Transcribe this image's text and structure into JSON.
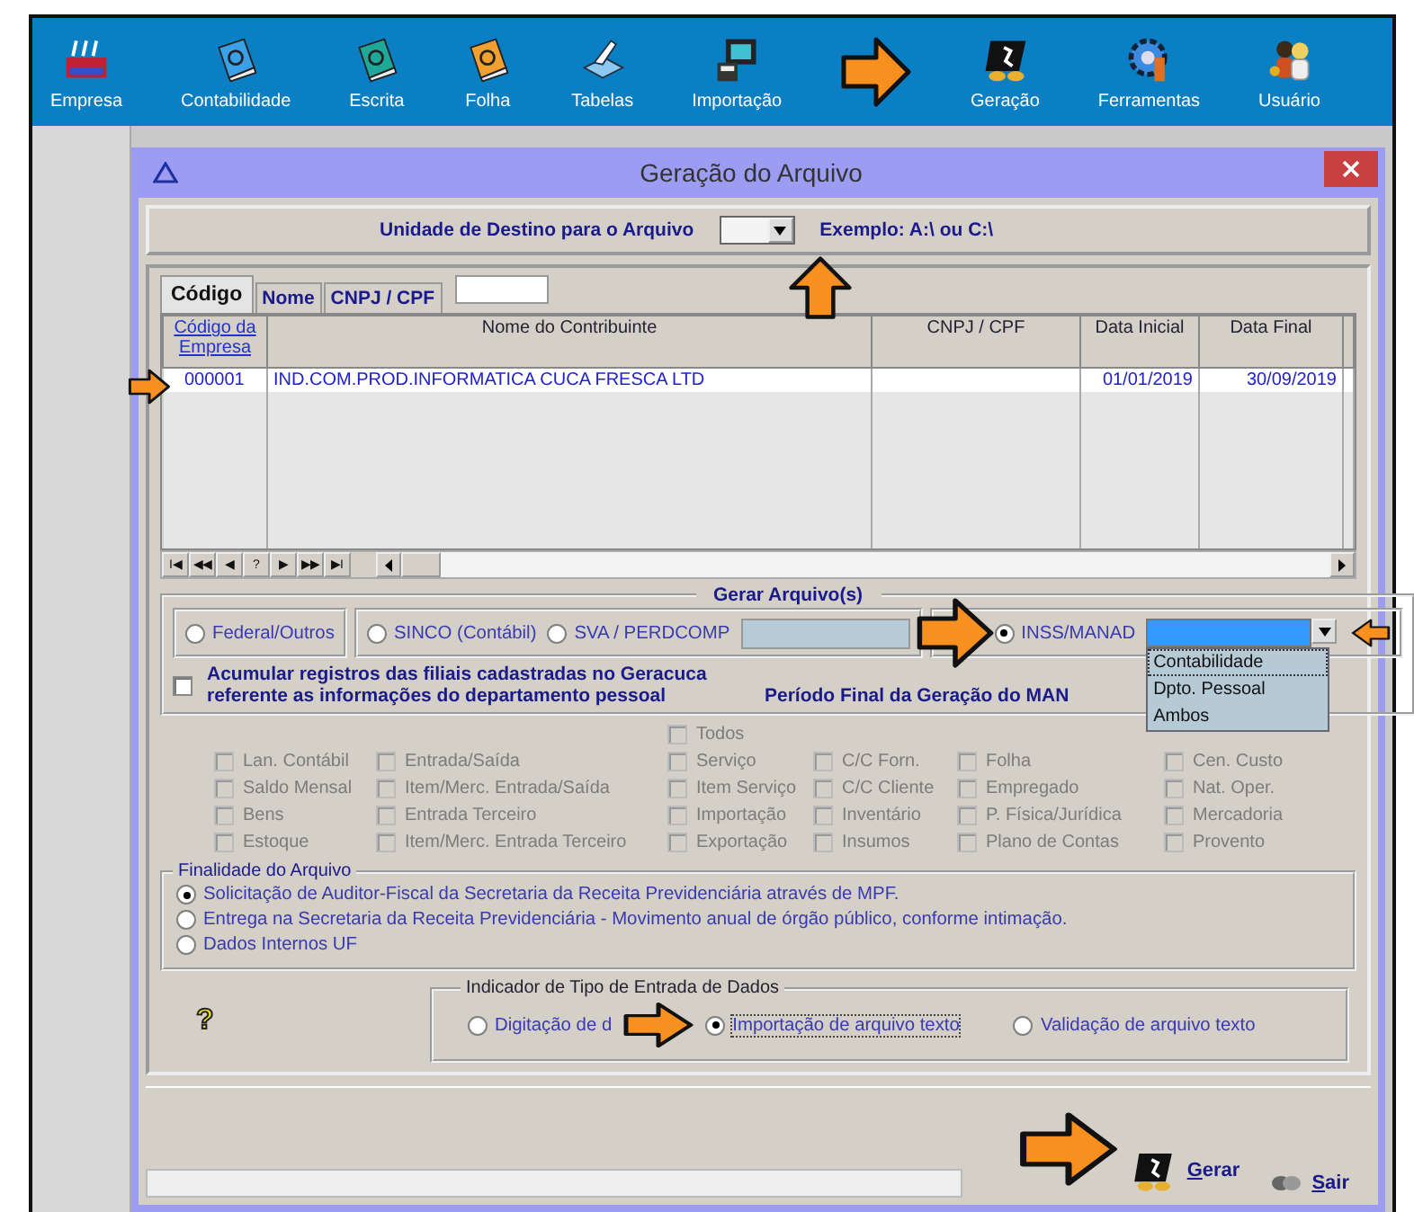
{
  "toolbar": {
    "items": [
      {
        "label": "Empresa"
      },
      {
        "label": "Contabilidade"
      },
      {
        "label": "Escrita"
      },
      {
        "label": "Folha"
      },
      {
        "label": "Tabelas"
      },
      {
        "label": "Importação"
      },
      {
        "label": "Geração"
      },
      {
        "label": "Ferramentas"
      },
      {
        "label": "Usuário"
      }
    ]
  },
  "dialog": {
    "title": "Geração do Arquivo",
    "destination": {
      "label": "Unidade de Destino para o Arquivo",
      "example": "Exemplo: A:\\ ou  C:\\"
    },
    "tabs": [
      {
        "label": "Código",
        "selected": true
      },
      {
        "label": "Nome",
        "selected": false
      },
      {
        "label": "CNPJ / CPF",
        "selected": false
      }
    ],
    "grid": {
      "columns": [
        {
          "label": "Código da Empresa",
          "linked": true
        },
        {
          "label": "Nome do Contribuinte",
          "linked": false
        },
        {
          "label": "CNPJ / CPF",
          "linked": false
        },
        {
          "label": "Data Inicial",
          "linked": false
        },
        {
          "label": "Data Final",
          "linked": false
        }
      ],
      "rows": [
        {
          "cells": [
            "000001",
            "IND.COM.PROD.INFORMATICA CUCA FRESCA LTD",
            "",
            "01/01/2019",
            "30/09/2019"
          ]
        }
      ],
      "nav_buttons": [
        "I◀",
        "◀◀",
        "◀",
        "?",
        "▶",
        "▶▶",
        "▶I"
      ]
    }
  },
  "gerar": {
    "title": "Gerar Arquivo(s)",
    "options": [
      {
        "label": "Federal/Outros",
        "selected": false
      },
      {
        "label": "SINCO (Contábil)",
        "selected": false
      },
      {
        "label": "SVA / PERDCOMP",
        "selected": false
      },
      {
        "label": "INSS/MANAD",
        "selected": true
      }
    ],
    "dropdown_options": [
      {
        "label": "Contabilidade",
        "selected": true
      },
      {
        "label": "Dpto. Pessoal",
        "selected": false
      },
      {
        "label": "Ambos",
        "selected": false
      }
    ],
    "accumulate": {
      "label": "Acumular registros das filiais cadastradas no Geracuca referente as informações do departamento pessoal",
      "checked": false
    },
    "period_label": "Período Final da Geração do MAN"
  },
  "records": {
    "all": {
      "label": "Todos",
      "checked": false,
      "disabled": true
    },
    "items": [
      {
        "label": "Lan. Contábil",
        "checked": false,
        "disabled": true
      },
      {
        "label": "Entrada/Saída",
        "checked": false,
        "disabled": true
      },
      {
        "label": "Serviço",
        "checked": false,
        "disabled": true
      },
      {
        "label": "C/C Forn.",
        "checked": false,
        "disabled": true
      },
      {
        "label": "Folha",
        "checked": false,
        "disabled": true
      },
      {
        "label": "Cen. Custo",
        "checked": false,
        "disabled": true
      },
      {
        "label": "Saldo Mensal",
        "checked": false,
        "disabled": true
      },
      {
        "label": "Item/Merc. Entrada/Saída",
        "checked": false,
        "disabled": true
      },
      {
        "label": "Item Serviço",
        "checked": false,
        "disabled": true
      },
      {
        "label": "C/C Cliente",
        "checked": false,
        "disabled": true
      },
      {
        "label": "Empregado",
        "checked": false,
        "disabled": true
      },
      {
        "label": "Nat. Oper.",
        "checked": false,
        "disabled": true
      },
      {
        "label": "Bens",
        "checked": false,
        "disabled": true
      },
      {
        "label": "Entrada Terceiro",
        "checked": false,
        "disabled": true
      },
      {
        "label": "Importação",
        "checked": false,
        "disabled": true
      },
      {
        "label": "Inventário",
        "checked": false,
        "disabled": true
      },
      {
        "label": "P. Física/Jurídica",
        "checked": false,
        "disabled": true
      },
      {
        "label": "Mercadoria",
        "checked": false,
        "disabled": true
      },
      {
        "label": "Estoque",
        "checked": false,
        "disabled": true
      },
      {
        "label": "Item/Merc. Entrada Terceiro",
        "checked": false,
        "disabled": true
      },
      {
        "label": "Exportação",
        "checked": false,
        "disabled": true
      },
      {
        "label": "Insumos",
        "checked": false,
        "disabled": true
      },
      {
        "label": "Plano de Contas",
        "checked": false,
        "disabled": true
      },
      {
        "label": "Provento",
        "checked": false,
        "disabled": true
      }
    ]
  },
  "purpose": {
    "title": "Finalidade do Arquivo",
    "options": [
      {
        "label": "Solicitação de Auditor-Fiscal da Secretaria da Receita Previdenciária através de MPF.",
        "selected": true
      },
      {
        "label": "Entrega na Secretaria da Receita Previdenciária - Movimento anual de órgão público, conforme intimação.",
        "selected": false
      },
      {
        "label": "Dados Internos UF",
        "selected": false
      }
    ]
  },
  "input_type": {
    "title": "Indicador de Tipo de Entrada de Dados",
    "help": "?",
    "options": [
      {
        "label": "Digitação de d",
        "selected": false
      },
      {
        "label": "Importação de arquivo texto",
        "selected": true
      },
      {
        "label": "Validação de arquivo texto",
        "selected": false
      }
    ]
  },
  "actions": [
    {
      "label": "Gerar",
      "kind": "generate"
    },
    {
      "label": "Sair",
      "kind": "exit"
    }
  ]
}
